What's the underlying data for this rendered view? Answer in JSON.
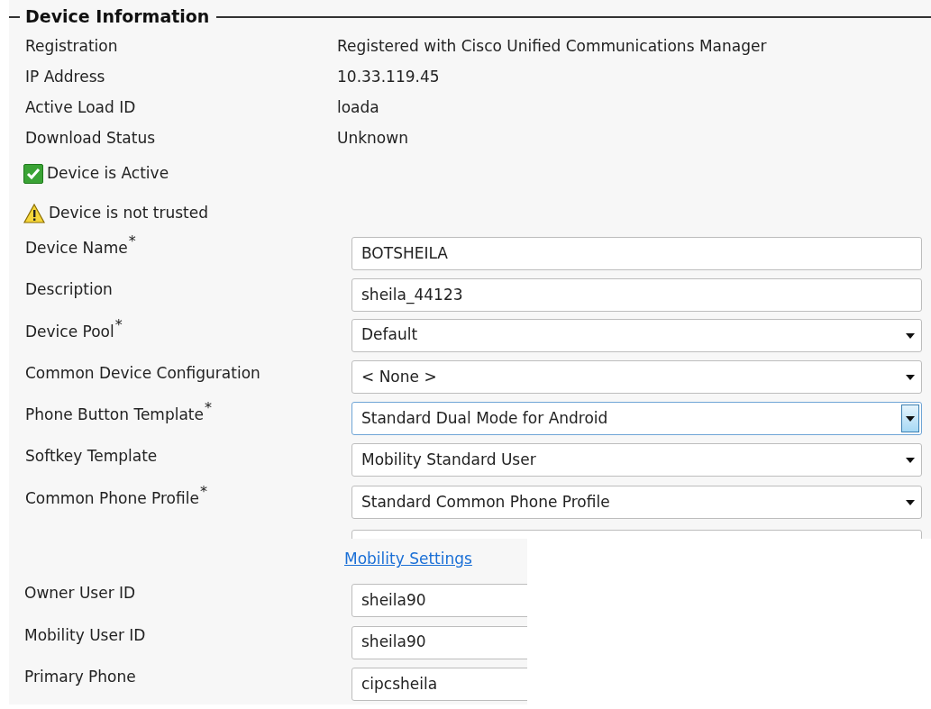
{
  "section": {
    "title": "Device Information"
  },
  "info_rows": [
    {
      "label": "Registration",
      "value": "Registered with Cisco Unified Communications Manager"
    },
    {
      "label": "IP Address",
      "value": "10.33.119.45"
    },
    {
      "label": "Active Load ID",
      "value": "loada"
    },
    {
      "label": "Download Status",
      "value": "Unknown"
    }
  ],
  "status_notes": [
    {
      "kind": "ok",
      "text": "Device is Active"
    },
    {
      "kind": "warning",
      "text": "Device is not trusted"
    }
  ],
  "fields": [
    {
      "kind": "text",
      "label": "Device Name",
      "asterisk": "*",
      "value": "BOTSHEILA"
    },
    {
      "kind": "text",
      "label": "Description",
      "value": "sheila_44123"
    },
    {
      "kind": "dropdown",
      "label": "Device Pool",
      "asterisk": "*",
      "value": "Default",
      "focused": false
    },
    {
      "kind": "dropdown",
      "label": "Common Device Configuration",
      "value": "< None >",
      "focused": false
    },
    {
      "kind": "dropdown",
      "label": "Phone Button Template",
      "asterisk": "*",
      "value": "Standard Dual Mode for Android",
      "focused": true
    },
    {
      "kind": "dropdown",
      "label": "Softkey Template",
      "value": "Mobility Standard User",
      "focused": false
    },
    {
      "kind": "dropdown",
      "label": "Common Phone Profile",
      "asterisk": "*",
      "value": "Standard Common Phone Profile",
      "focused": false
    },
    {
      "kind": "clipped"
    }
  ],
  "mobility": {
    "link": "Mobility Settings",
    "fields": [
      {
        "label": "Owner User ID",
        "value": "sheila90"
      },
      {
        "label": "Mobility User ID",
        "value": "sheila90"
      },
      {
        "label": "Primary Phone",
        "value": "cipcsheila"
      }
    ]
  }
}
